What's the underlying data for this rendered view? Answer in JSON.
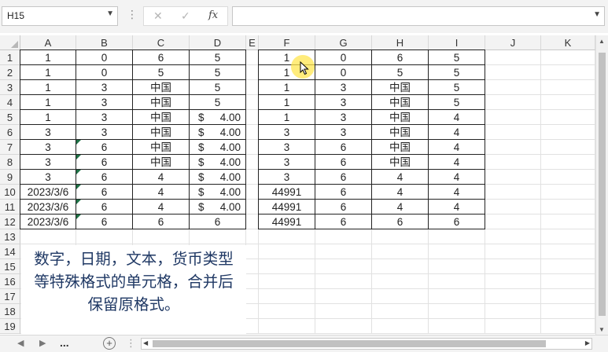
{
  "namebox": {
    "value": "H15"
  },
  "formula": {
    "value": ""
  },
  "icons": {
    "cancel": "✕",
    "enter": "✓",
    "fx": "fx"
  },
  "columns": [
    "A",
    "B",
    "C",
    "D",
    "E",
    "F",
    "G",
    "H",
    "I",
    "J",
    "K"
  ],
  "rows": [
    "1",
    "2",
    "3",
    "4",
    "5",
    "6",
    "7",
    "8",
    "9",
    "10",
    "11",
    "12",
    "13",
    "14",
    "15",
    "16",
    "17",
    "18",
    "19"
  ],
  "left_table": [
    [
      "1",
      "0",
      "6",
      "5"
    ],
    [
      "1",
      "0",
      "5",
      "5"
    ],
    [
      "1",
      "3",
      "中国",
      "5"
    ],
    [
      "1",
      "3",
      "中国",
      "5"
    ],
    [
      "1",
      "3",
      "中国",
      "$ 4.00"
    ],
    [
      "3",
      "3",
      "中国",
      "$ 4.00"
    ],
    [
      "3",
      "6",
      "中国",
      "$ 4.00"
    ],
    [
      "3",
      "6",
      "中国",
      "$ 4.00"
    ],
    [
      "3",
      "6",
      "4",
      "$ 4.00"
    ],
    [
      "2023/3/6",
      "6",
      "4",
      "$ 4.00"
    ],
    [
      "2023/3/6",
      "6",
      "4",
      "$ 4.00"
    ],
    [
      "2023/3/6",
      "6",
      "6",
      "6"
    ]
  ],
  "right_table": [
    [
      "1",
      "0",
      "6",
      "5"
    ],
    [
      "1",
      "0",
      "5",
      "5"
    ],
    [
      "1",
      "3",
      "中国",
      "5"
    ],
    [
      "1",
      "3",
      "中国",
      "5"
    ],
    [
      "1",
      "3",
      "中国",
      "4"
    ],
    [
      "3",
      "3",
      "中国",
      "4"
    ],
    [
      "3",
      "6",
      "中国",
      "4"
    ],
    [
      "3",
      "6",
      "中国",
      "4"
    ],
    [
      "3",
      "6",
      "4",
      "4"
    ],
    [
      "44991",
      "6",
      "4",
      "4"
    ],
    [
      "44991",
      "6",
      "4",
      "4"
    ],
    [
      "44991",
      "6",
      "6",
      "6"
    ]
  ],
  "note": {
    "line1": "数字，日期，文本，货币类型",
    "line2": "等特殊格式的单元格，合并后",
    "line3": "保留原格式。"
  },
  "sheet_bar": {
    "more": "..."
  },
  "colors": {
    "error_triangle": "#1e7145",
    "note_text": "#1f3864",
    "cursor_highlight": "#ffe650"
  }
}
